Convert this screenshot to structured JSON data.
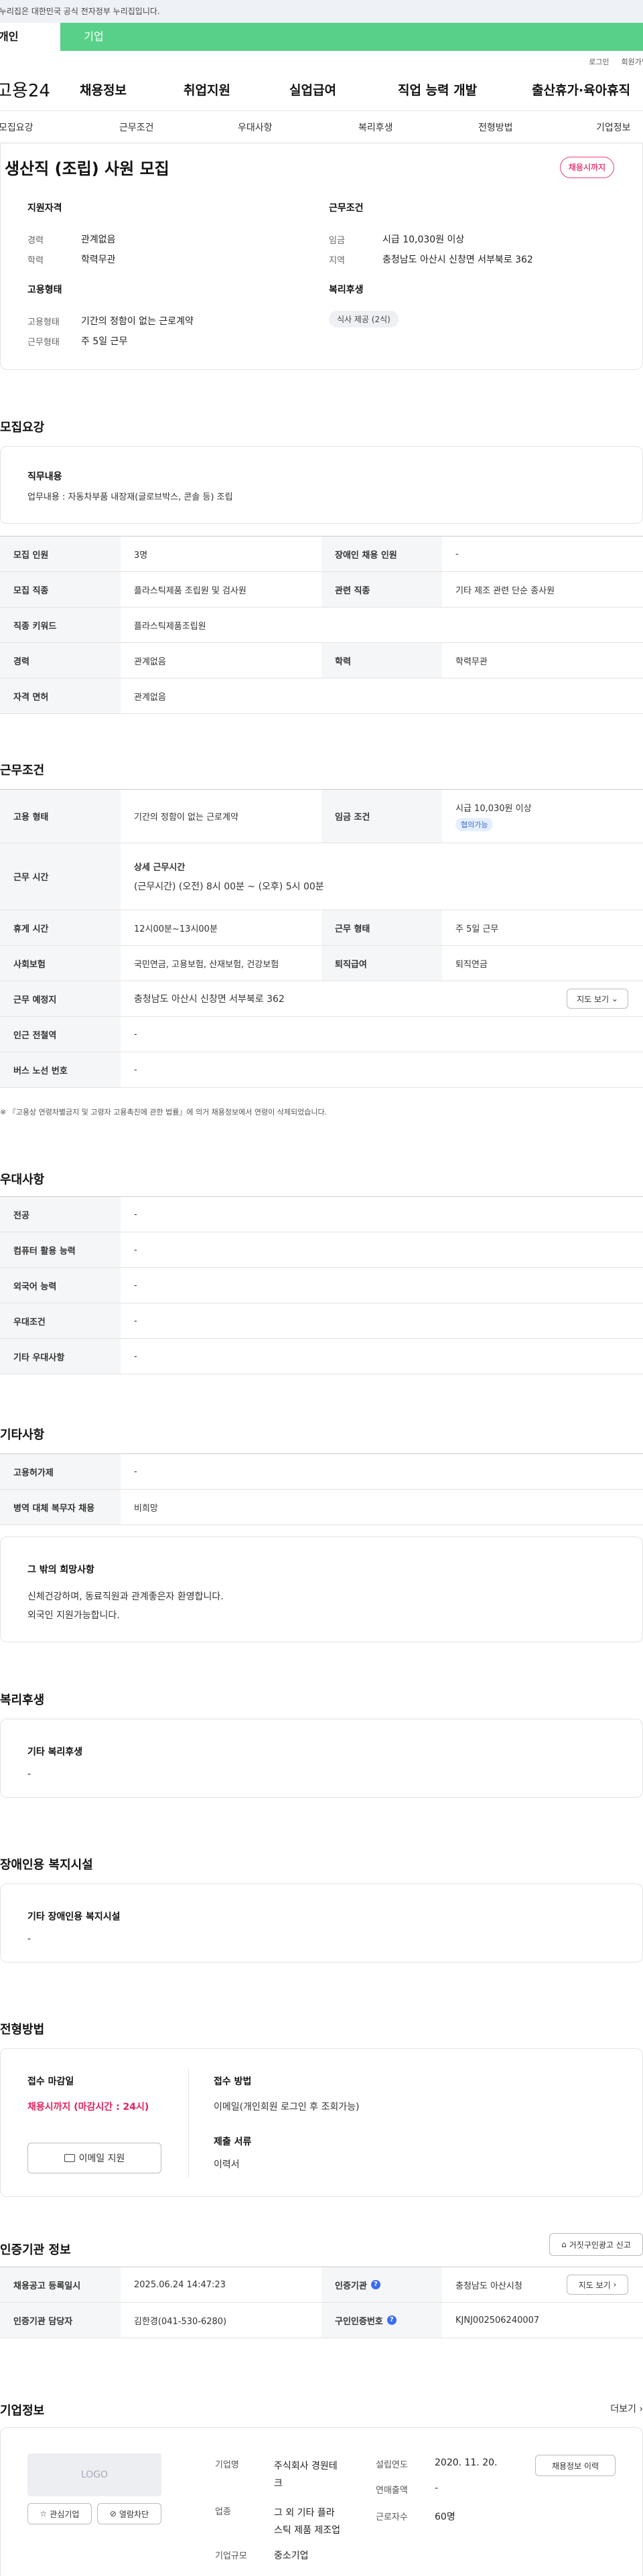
{
  "gov_notice": "이 누리집은 대한민국 공식 전자정부 누리집입니다.",
  "tabs": [
    "개인",
    "기업"
  ],
  "util": [
    "로그인",
    "회원가입"
  ],
  "gnb": {
    "logo": "고용24",
    "menus": [
      "채용정보",
      "취업지원",
      "실업급여",
      "직업 능력 개발",
      "출산휴가·육아휴직"
    ]
  },
  "subnav": [
    "모집요강",
    "근무조건",
    "우대사항",
    "복리후생",
    "전형방법",
    "기업정보"
  ],
  "hero": {
    "title": "생산직 (조립) 사원 모집",
    "status_badge": "채용시까지",
    "qualification": {
      "title": "지원자격",
      "rows": [
        {
          "k": "경력",
          "v": "관계없음"
        },
        {
          "k": "학력",
          "v": "학력무관"
        }
      ]
    },
    "employment": {
      "title": "고용형태",
      "rows": [
        {
          "k": "고용형태",
          "v": "기간의 정함이 없는 근로계약"
        },
        {
          "k": "근무형태",
          "v": "주 5일 근무"
        }
      ]
    },
    "conditions": {
      "title": "근무조건",
      "rows": [
        {
          "k": "임금",
          "v": "시급 10,030원 이상"
        },
        {
          "k": "지역",
          "v": "충청남도 아산시 신창면 서부북로 362"
        }
      ]
    },
    "welfare": {
      "title": "복리후생",
      "chip": "식사 제공 (2식)"
    }
  },
  "recruit": {
    "section_title": "모집요강",
    "duty_title": "직무내용",
    "duty_text": "업무내용 : 자동차부품 내장재(글로브박스, 콘솔 등) 조립",
    "table": {
      "headcount_label": "모집 인원",
      "headcount": "3명",
      "disabled_label": "장애인 채용 인원",
      "disabled": "-",
      "job_label": "모집 직종",
      "job": "플라스틱제품 조립원 및 검사원",
      "related_label": "관련 직종",
      "related": "기타 제조 관련 단순 종사원",
      "keyword_label": "직종 키워드",
      "keyword": "플라스틱제품조립원",
      "career_label": "경력",
      "career": "관계없음",
      "edu_label": "학력",
      "edu": "학력무관",
      "license_label": "자격 면허",
      "license": "관계없음"
    }
  },
  "work": {
    "section_title": "근무조건",
    "type_label": "고용 형태",
    "type": "기간의 정함이 없는 근로계약",
    "wage_label": "임금 조건",
    "wage": "시급 10,030원 이상",
    "wage_chip": "협의가능",
    "time_label": "근무 시간",
    "time_title": "상세 근무시간",
    "time": "(근무시간) (오전) 8시 00분 ~ (오후) 5시 00분",
    "rest_label": "휴게 시간",
    "rest": "12시00분~13시00분",
    "form_label": "근무 형태",
    "form": "주 5일 근무",
    "insurance_label": "사회보험",
    "insurance": "국민연금, 고용보험, 산재보험, 건강보험",
    "retire_label": "퇴직급여",
    "retire": "퇴직연금",
    "place_label": "근무 예정지",
    "place": "충청남도 아산시 신창면 서부북로 362",
    "map_btn": "지도 보기",
    "station_label": "인근 전철역",
    "station": "-",
    "bus_label": "버스 노선 번호",
    "bus": "-",
    "footnote": "※ 『고용상 연령차별금지 및 고령자 고용촉진에 관한 법률』에 의거 채용정보에서 연령이 삭제되었습니다."
  },
  "pref": {
    "section_title": "우대사항",
    "rows": [
      {
        "k": "전공",
        "v": "-"
      },
      {
        "k": "컴퓨터 활용 능력",
        "v": "-"
      },
      {
        "k": "외국어 능력",
        "v": "-"
      },
      {
        "k": "우대조건",
        "v": "-"
      },
      {
        "k": "기타 우대사항",
        "v": "-"
      }
    ]
  },
  "etc": {
    "section_title": "기타사항",
    "rows": [
      {
        "k": "고용허가제",
        "v": "-"
      },
      {
        "k": "병역 대체 복무자 채용",
        "v": "비희망"
      }
    ],
    "wish_title": "그 밖의 희망사항",
    "wish_line1": "신체건강하며, 동료직원과 관계좋은자 환영합니다.",
    "wish_line2": "외국인 지원가능합니다."
  },
  "welfare": {
    "section_title": "복리후생",
    "box_title": "기타 복리후생",
    "box_value": "-"
  },
  "disability": {
    "section_title": "장애인용 복지시설",
    "box_title": "기타 장애인용 복지시설",
    "box_value": "-"
  },
  "selection": {
    "section_title": "전형방법",
    "deadline_title": "접수 마감일",
    "deadline": "채용시까지 (마감시간 : 24시)",
    "email_btn": "이메일 지원",
    "method_title": "접수 방법",
    "method": "이메일(개인회원 로그인 후 조회가능)",
    "docs_title": "제출 서류",
    "docs": "이력서"
  },
  "agency": {
    "section_title": "인증기관 정보",
    "report_btn": "거짓구인광고 신고",
    "reg_label": "채용공고 등록일시",
    "reg": "2025.06.24 14:47:23",
    "org_label": "인증기관",
    "org": "충청남도 아산시청",
    "map_btn": "지도 보기",
    "manager_label": "인증기관 담당자",
    "manager": "김한경(041-530-6280)",
    "no_label": "구인인증번호",
    "no": "KJNJ002506240007"
  },
  "company": {
    "section_title": "기업정보",
    "more": "더보기",
    "logo_text": "LOGO",
    "fav_btn": "관심기업",
    "block_btn": "열람차단",
    "name_label": "기업명",
    "name": "주식회사 경원테크",
    "industry_label": "업종",
    "industry": "그 외 기타 플라스틱 제품 제조업",
    "size_label": "기업규모",
    "size": "중소기업",
    "founded_label": "설립연도",
    "founded": "2020. 11. 20.",
    "sales_label": "연매출액",
    "sales": "-",
    "workers_label": "근로자수",
    "workers": "60명",
    "jobs_btn": "채용정보 이력"
  }
}
